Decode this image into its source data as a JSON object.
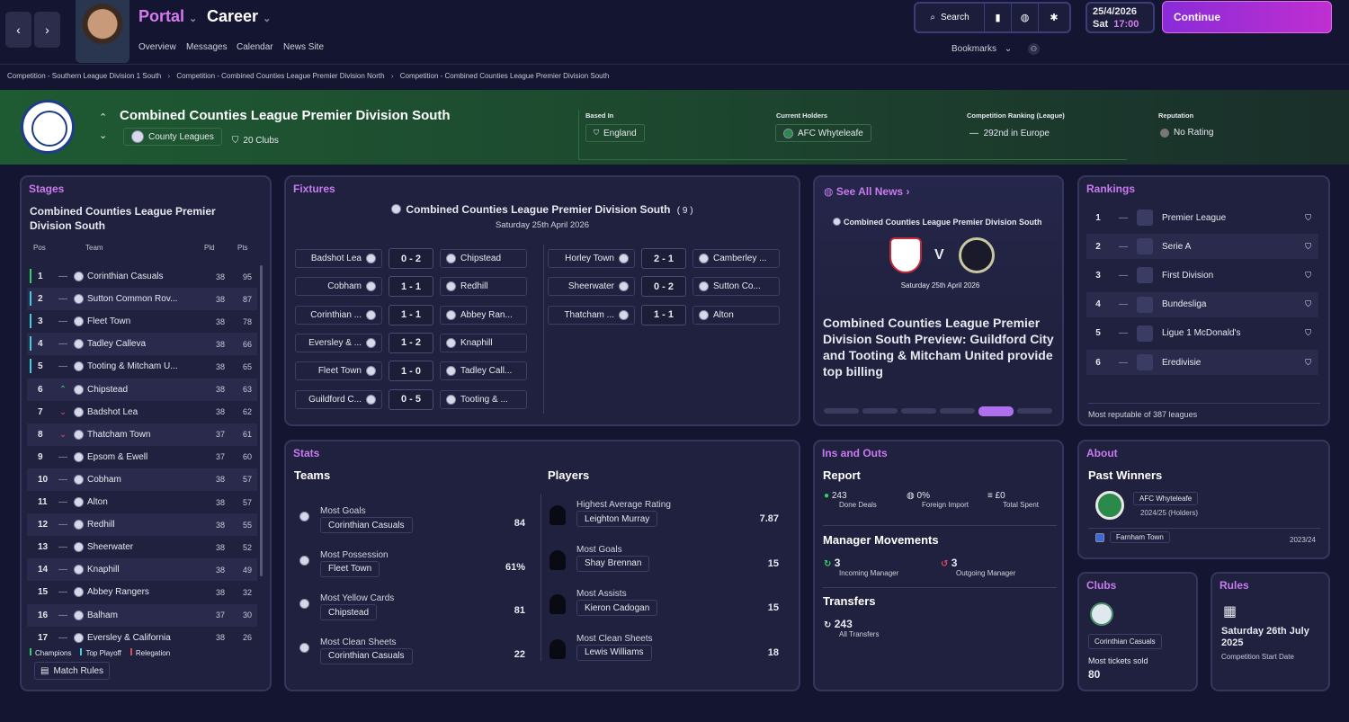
{
  "header": {
    "portal": "Portal",
    "career": "Career",
    "subnav": [
      "Overview",
      "Messages",
      "Calendar",
      "News Site"
    ],
    "search": "Search",
    "bookmarks": "Bookmarks",
    "date": "25/4/2026",
    "day": "Sat",
    "time": "17:00",
    "continue": "Continue"
  },
  "breadcrumbs": [
    "Competition - Southern League Division 1 South",
    "Competition - Combined Counties League Premier Division North",
    "Competition - Combined Counties League Premier Division South"
  ],
  "competition": {
    "name": "Combined Counties League Premier Division South",
    "level": "County Leagues",
    "clubs": "20 Clubs",
    "based_in_label": "Based In",
    "based_in": "England",
    "holders_label": "Current Holders",
    "holders": "AFC Whyteleafe",
    "ranking_label": "Competition Ranking (League)",
    "ranking": "292nd in Europe",
    "reputation_label": "Reputation",
    "reputation": "No Rating"
  },
  "stages": {
    "title": "Stages",
    "comp": "Combined Counties League Premier Division South",
    "cols": {
      "pos": "Pos",
      "team": "Team",
      "pld": "Pld",
      "pts": "Pts"
    },
    "rows": [
      {
        "pos": "1",
        "mv": "—",
        "team": "Corinthian Casuals",
        "pld": "38",
        "pts": "95",
        "zone": "#35d06a"
      },
      {
        "pos": "2",
        "mv": "—",
        "team": "Sutton Common Rov...",
        "pld": "38",
        "pts": "87",
        "zone": "#3fd0e0"
      },
      {
        "pos": "3",
        "mv": "—",
        "team": "Fleet Town",
        "pld": "38",
        "pts": "78",
        "zone": "#3fd0e0"
      },
      {
        "pos": "4",
        "mv": "—",
        "team": "Tadley Calleva",
        "pld": "38",
        "pts": "66",
        "zone": "#3fd0e0"
      },
      {
        "pos": "5",
        "mv": "—",
        "team": "Tooting & Mitcham U...",
        "pld": "38",
        "pts": "65",
        "zone": "#3fd0e0"
      },
      {
        "pos": "6",
        "mv": "^",
        "team": "Chipstead",
        "pld": "38",
        "pts": "63",
        "zone": ""
      },
      {
        "pos": "7",
        "mv": "v",
        "team": "Badshot Lea",
        "pld": "38",
        "pts": "62",
        "zone": ""
      },
      {
        "pos": "8",
        "mv": "v",
        "team": "Thatcham Town",
        "pld": "37",
        "pts": "61",
        "zone": ""
      },
      {
        "pos": "9",
        "mv": "—",
        "team": "Epsom & Ewell",
        "pld": "37",
        "pts": "60",
        "zone": ""
      },
      {
        "pos": "10",
        "mv": "—",
        "team": "Cobham",
        "pld": "38",
        "pts": "57",
        "zone": ""
      },
      {
        "pos": "11",
        "mv": "—",
        "team": "Alton",
        "pld": "38",
        "pts": "57",
        "zone": ""
      },
      {
        "pos": "12",
        "mv": "—",
        "team": "Redhill",
        "pld": "38",
        "pts": "55",
        "zone": ""
      },
      {
        "pos": "13",
        "mv": "—",
        "team": "Sheerwater",
        "pld": "38",
        "pts": "52",
        "zone": ""
      },
      {
        "pos": "14",
        "mv": "—",
        "team": "Knaphill",
        "pld": "38",
        "pts": "49",
        "zone": ""
      },
      {
        "pos": "15",
        "mv": "—",
        "team": "Abbey Rangers",
        "pld": "38",
        "pts": "32",
        "zone": ""
      },
      {
        "pos": "16",
        "mv": "—",
        "team": "Balham",
        "pld": "37",
        "pts": "30",
        "zone": ""
      },
      {
        "pos": "17",
        "mv": "—",
        "team": "Eversley & California",
        "pld": "38",
        "pts": "26",
        "zone": ""
      }
    ],
    "legend": {
      "champions": "Champions",
      "playoff": "Top Playoff",
      "relegation": "Relegation"
    },
    "match_rules": "Match Rules"
  },
  "fixtures": {
    "title": "Fixtures",
    "comp": "Combined Counties League Premier Division South",
    "count": "( 9 )",
    "date": "Saturday 25th April 2026",
    "left": [
      {
        "home": "Badshot Lea",
        "score": "0 - 2",
        "away": "Chipstead"
      },
      {
        "home": "Cobham",
        "score": "1 - 1",
        "away": "Redhill"
      },
      {
        "home": "Corinthian ...",
        "score": "1 - 1",
        "away": "Abbey Ran..."
      },
      {
        "home": "Eversley & ...",
        "score": "1 - 2",
        "away": "Knaphill"
      },
      {
        "home": "Fleet Town",
        "score": "1 - 0",
        "away": "Tadley Call..."
      },
      {
        "home": "Guildford C...",
        "score": "0 - 5",
        "away": "Tooting & ..."
      }
    ],
    "right": [
      {
        "home": "Horley Town",
        "score": "2 - 1",
        "away": "Camberley ..."
      },
      {
        "home": "Sheerwater",
        "score": "0 - 2",
        "away": "Sutton Co..."
      },
      {
        "home": "Thatcham ...",
        "score": "1 - 1",
        "away": "Alton"
      }
    ]
  },
  "news": {
    "see_all": "See All News",
    "comp": "Combined Counties League Premier Division South",
    "vs": "V",
    "date": "Saturday 25th April 2026",
    "headline": "Combined Counties League Premier Division South Preview: Guildford City and Tooting & Mitcham United provide top billing"
  },
  "rankings": {
    "title": "Rankings",
    "rows": [
      {
        "rank": "1",
        "mv": "—",
        "league": "Premier League"
      },
      {
        "rank": "2",
        "mv": "—",
        "league": "Serie A"
      },
      {
        "rank": "3",
        "mv": "—",
        "league": "First Division"
      },
      {
        "rank": "4",
        "mv": "—",
        "league": "Bundesliga"
      },
      {
        "rank": "5",
        "mv": "—",
        "league": "Ligue 1 McDonald's"
      },
      {
        "rank": "6",
        "mv": "—",
        "league": "Eredivisie"
      }
    ],
    "footer": "Most reputable of 387 leagues"
  },
  "stats": {
    "title": "Stats",
    "teams": "Teams",
    "players": "Players",
    "team_stats": [
      {
        "label": "Most Goals",
        "team": "Corinthian Casuals",
        "value": "84"
      },
      {
        "label": "Most Possession",
        "team": "Fleet Town",
        "value": "61%"
      },
      {
        "label": "Most Yellow Cards",
        "team": "Chipstead",
        "value": "81"
      },
      {
        "label": "Most Clean Sheets",
        "team": "Corinthian Casuals",
        "value": "22"
      }
    ],
    "player_stats": [
      {
        "label": "Highest Average Rating",
        "player": "Leighton Murray",
        "value": "7.87"
      },
      {
        "label": "Most Goals",
        "player": "Shay Brennan",
        "value": "15"
      },
      {
        "label": "Most Assists",
        "player": "Kieron Cadogan",
        "value": "15"
      },
      {
        "label": "Most Clean Sheets",
        "player": "Lewis Williams",
        "value": "18"
      }
    ]
  },
  "ins": {
    "title": "Ins and Outs",
    "report": "Report",
    "done": "243",
    "done_lab": "Done Deals",
    "foreign": "0%",
    "foreign_lab": "Foreign Import",
    "spent": "£0",
    "spent_lab": "Total Spent",
    "mm": "Manager Movements",
    "inc": "3",
    "inc_lab": "Incoming Manager",
    "out": "3",
    "out_lab": "Outgoing Manager",
    "transfers": "Transfers",
    "all": "243",
    "all_lab": "All Transfers"
  },
  "about": {
    "title": "About",
    "past": "Past Winners",
    "w1": "AFC Whyteleafe",
    "w1_season": "2024/25 (Holders)",
    "w2": "Farnham Town",
    "w2_season": "2023/24"
  },
  "clubs": {
    "title": "Clubs",
    "club": "Corinthian Casuals",
    "lab": "Most tickets sold",
    "val": "80"
  },
  "rules": {
    "title": "Rules",
    "date": "Saturday 26th July 2025",
    "lab": "Competition Start Date"
  }
}
